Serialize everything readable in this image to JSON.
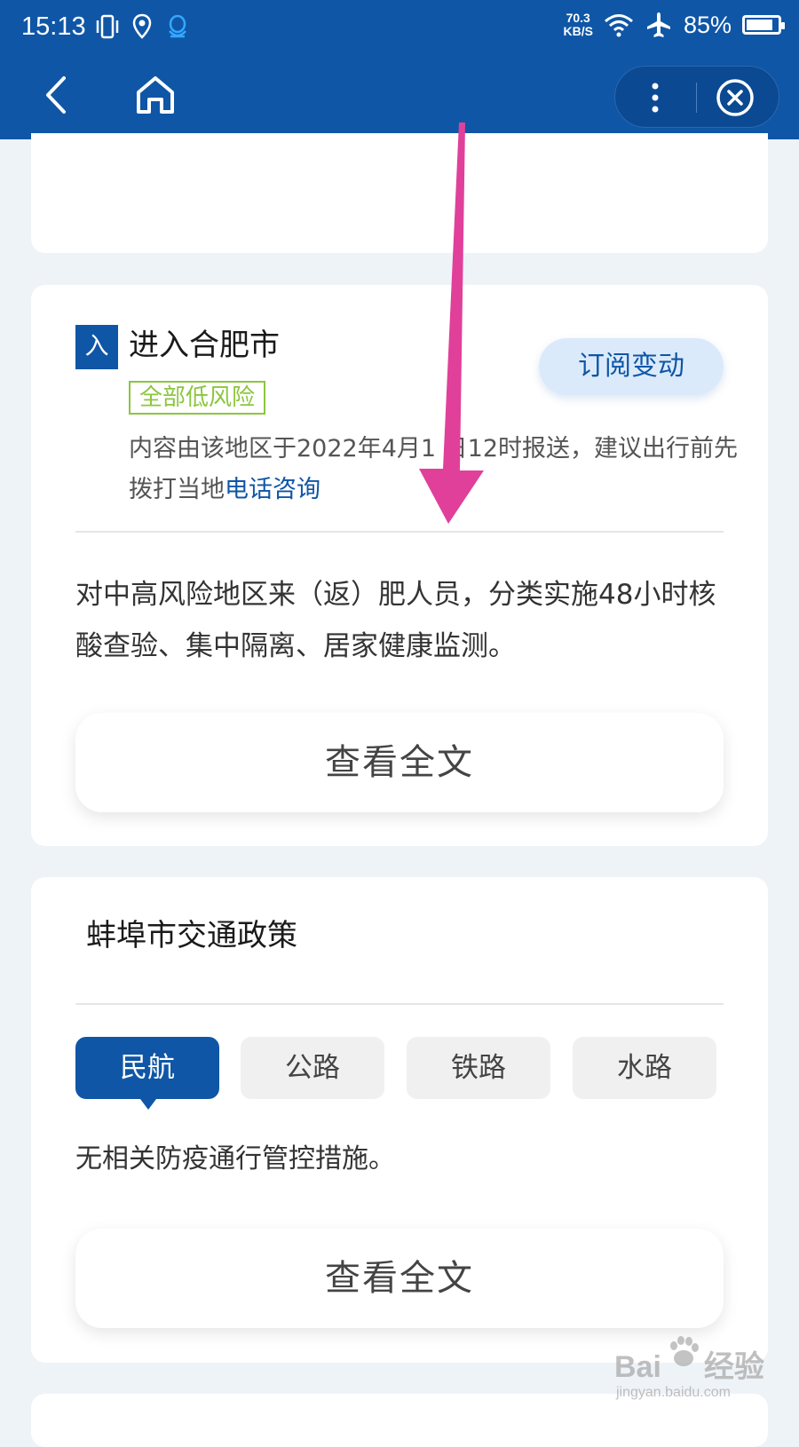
{
  "status_bar": {
    "time": "15:13",
    "net_speed_value": "70.3",
    "net_speed_unit": "KB/S",
    "battery_percent": "85%",
    "battery_level": 0.85,
    "icons": [
      "vibrate-icon",
      "location-icon",
      "qq-icon",
      "wifi-icon",
      "airplane-icon",
      "battery-icon"
    ]
  },
  "nav": {
    "icons": [
      "back-arrow-icon",
      "home-icon",
      "more-vertical-icon",
      "close-circle-icon"
    ]
  },
  "colors": {
    "brand_blue": "#0f56a6",
    "risk_green": "#8cc63f",
    "annotation_arrow": "#e0409a",
    "page_bg": "#eef3f8"
  },
  "hefei_card": {
    "badge": "入",
    "title": "进入合肥市",
    "risk_tag": "全部低风险",
    "subscribe_label": "订阅变动",
    "report_text": "内容由该地区于2022年4月1 日12时报送，建议出行前先拨打当地",
    "report_link": "电话咨询",
    "policy_text": "对中高风险地区来（返）肥人员，分类实施48小时核酸查验、集中隔离、居家健康监测。",
    "full_text_button": "查看全文"
  },
  "bengbu_card": {
    "title": "蚌埠市交通政策",
    "tabs": [
      "民航",
      "公路",
      "铁路",
      "水路"
    ],
    "active_tab": "民航",
    "content_text": "无相关防疫通行管控措施。",
    "full_text_button": "查看全文"
  },
  "watermark": {
    "brand": "Bai",
    "brand_suffix": "经验",
    "url": "jingyan.baidu.com"
  }
}
